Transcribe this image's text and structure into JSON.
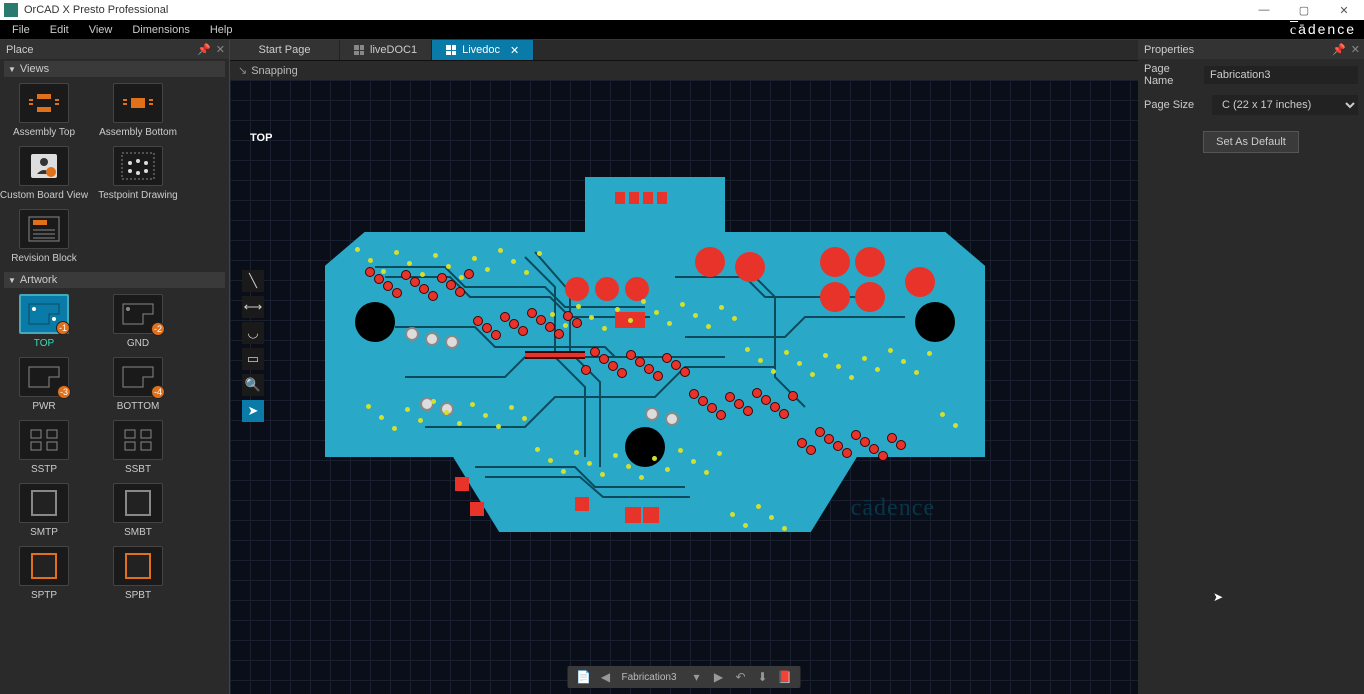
{
  "title": "OrCAD X Presto Professional",
  "menu": {
    "file": "File",
    "edit": "Edit",
    "view": "View",
    "dimensions": "Dimensions",
    "help": "Help"
  },
  "logo_suffix": "ādence",
  "place_panel": {
    "title": "Place"
  },
  "views_section": {
    "title": "Views",
    "items": [
      {
        "label": "Assembly Top"
      },
      {
        "label": "Assembly Bottom"
      },
      {
        "label": "Custom Board View"
      },
      {
        "label": "Testpoint Drawing"
      },
      {
        "label": "Revision Block"
      }
    ]
  },
  "artwork_section": {
    "title": "Artwork",
    "items": [
      {
        "label": "TOP",
        "badge": "-1",
        "selected": true
      },
      {
        "label": "GND",
        "badge": "-2"
      },
      {
        "label": "PWR",
        "badge": "-3"
      },
      {
        "label": "BOTTOM",
        "badge": "-4"
      },
      {
        "label": "SSTP"
      },
      {
        "label": "SSBT"
      },
      {
        "label": "SMTP"
      },
      {
        "label": "SMBT"
      },
      {
        "label": "SPTP"
      },
      {
        "label": "SPBT"
      }
    ]
  },
  "tabs": {
    "start": "Start Page",
    "doc1": "liveDOC1",
    "livedoc": "Livedoc"
  },
  "snapping": "Snapping",
  "canvas_label": "TOP",
  "pcb_logo": "cādence",
  "bottombar": {
    "doc": "Fabrication3"
  },
  "properties": {
    "title": "Properties",
    "pagename_label": "Page Name",
    "pagename_value": "Fabrication3",
    "pagesize_label": "Page Size",
    "pagesize_value": "C (22 x 17 inches)",
    "set_default": "Set As Default"
  }
}
